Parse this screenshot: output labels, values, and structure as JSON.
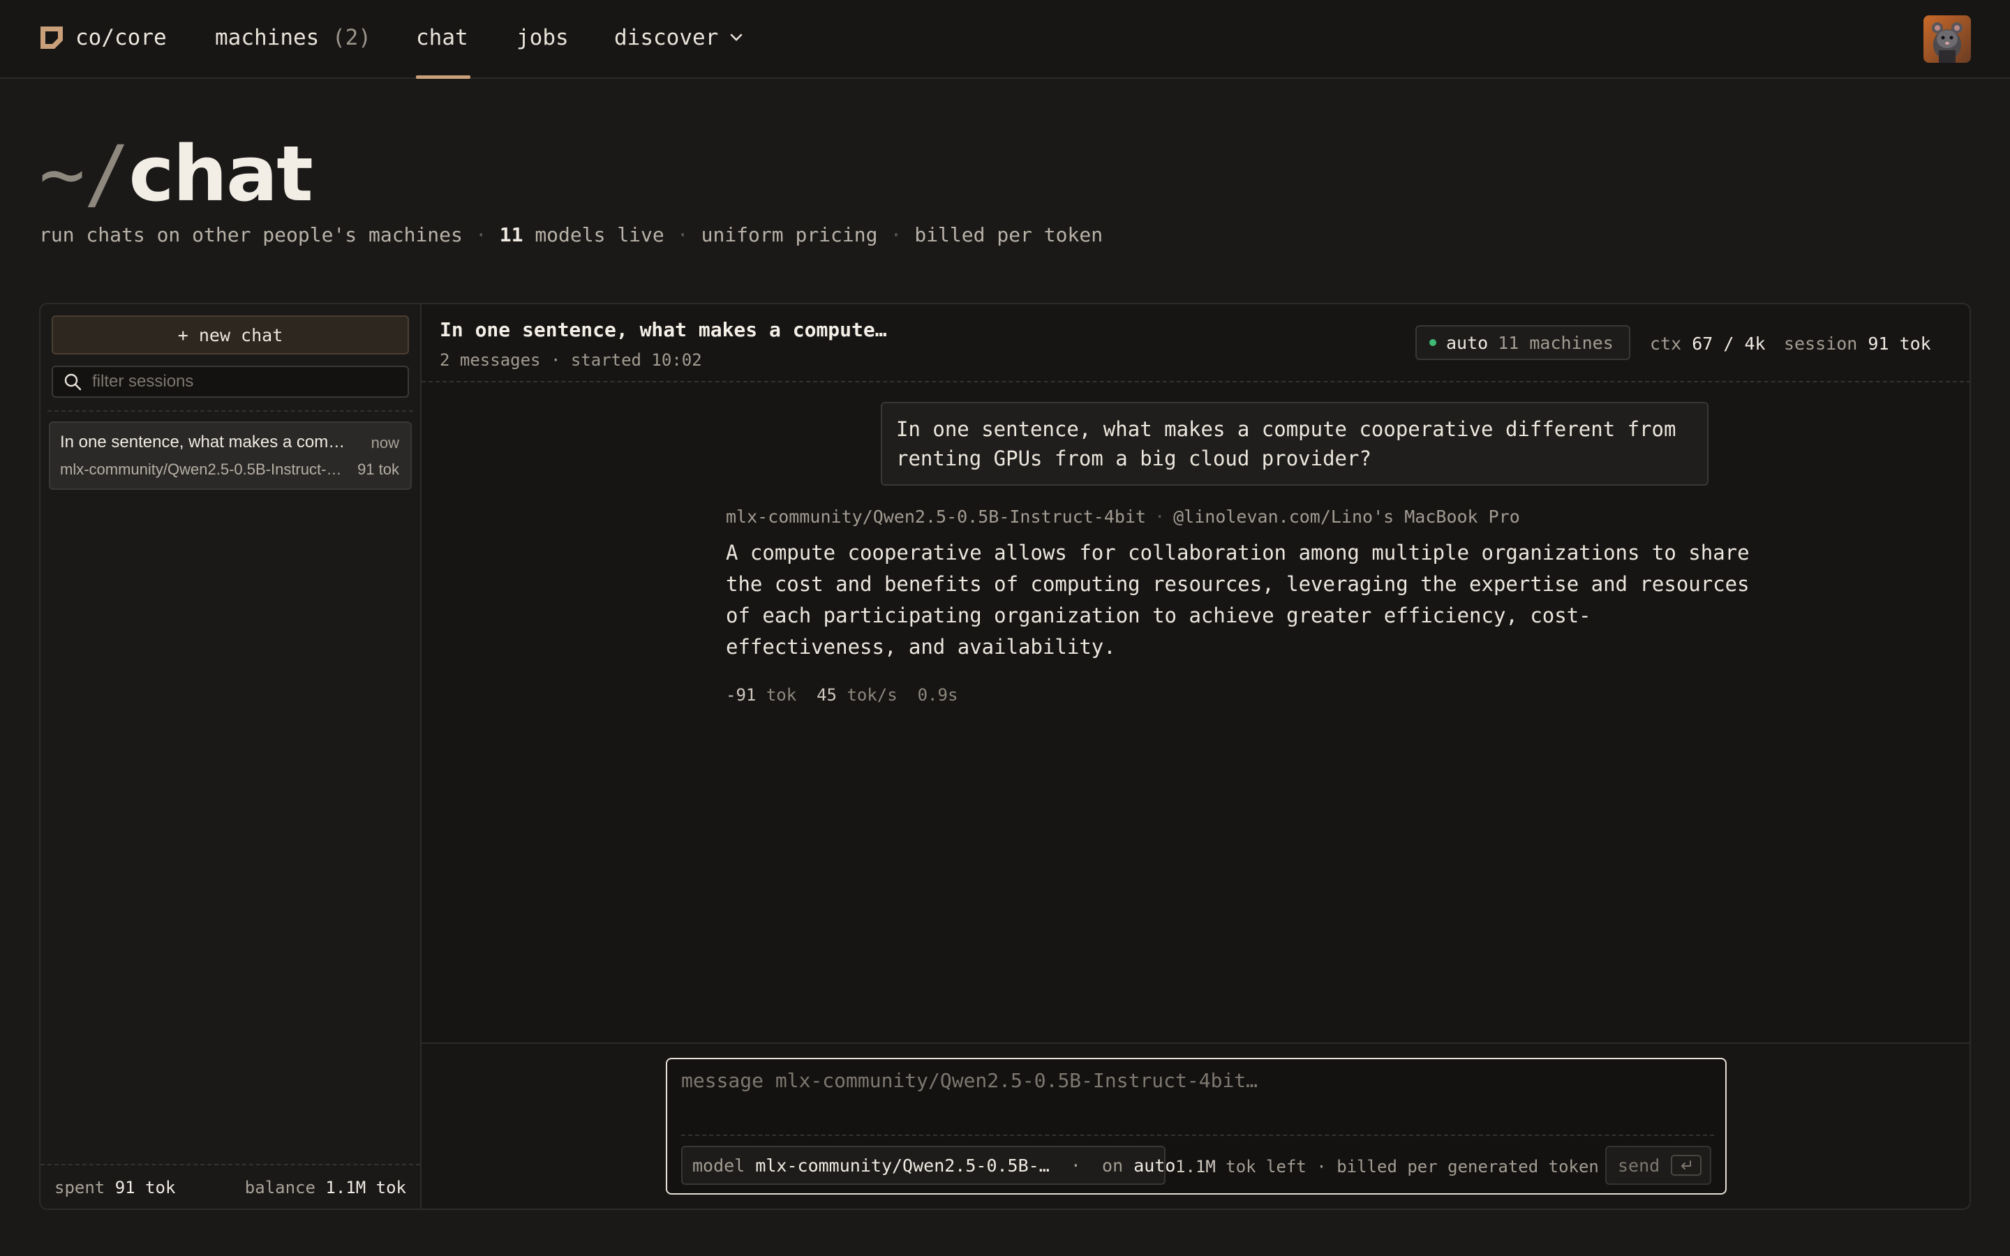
{
  "nav": {
    "brand": "co/core",
    "machines_label": "machines",
    "machines_count": "(2)",
    "chat_label": "chat",
    "jobs_label": "jobs",
    "discover_label": "discover",
    "active": "chat"
  },
  "hero": {
    "prefix": "~/",
    "title": "chat",
    "sub_1": "run chats on other people's machines",
    "models_count": "11",
    "models_label": "models live",
    "pricing": "uniform pricing",
    "billing": "billed per token"
  },
  "sidebar": {
    "new_chat": "+ new chat",
    "filter_placeholder": "filter sessions",
    "sessions": [
      {
        "title": "In one sentence, what makes a compute cooperative different from renting GPUs from a big cloud provider?",
        "time": "now",
        "model": "mlx-community/Qwen2.5-0.5B-Instruct-4bit",
        "tokens": "91 tok"
      }
    ],
    "footer": {
      "spent_label": "spent",
      "spent_value": "91 tok",
      "balance_label": "balance",
      "balance_value": "1.1M tok"
    }
  },
  "chat": {
    "title": "In one sentence, what makes a compute…",
    "meta": "2 messages · started 10:02",
    "routing": {
      "mode": "auto",
      "machines": "11 machines",
      "status_color": "#3fb974"
    },
    "ctx_label": "ctx",
    "ctx_value": "67 / 4k",
    "session_label": "session",
    "session_value": "91 tok",
    "user_message": "In one sentence, what makes a compute cooperative different from renting GPUs from a big cloud provider?",
    "reply_model": "mlx-community/Qwen2.5-0.5B-Instruct-4bit",
    "reply_host": "@linolevan.com/Lino's MacBook Pro",
    "reply_text": "A compute cooperative allows for collaboration among multiple organizations to share the cost and benefits of computing resources, leveraging the expertise and resources of each participating organization to achieve greater efficiency, cost-effectiveness, and availability.",
    "stats": {
      "tokens": "-91",
      "tokens_unit": "tok",
      "speed": "45",
      "speed_unit": "tok/s",
      "latency": "0.9s"
    }
  },
  "composer": {
    "placeholder": "message mlx-community/Qwen2.5-0.5B-Instruct-4bit…",
    "model_label": "model",
    "model_value": "mlx-community/Qwen2.5-0.5B-…",
    "on_label": "on",
    "on_value": "auto",
    "tok_left": "1.1M",
    "tok_left_label": "tok left · billed per generated token",
    "send": "send"
  },
  "colors": {
    "accent": "#c9a07a",
    "background": "#1a1918",
    "status_online": "#3fb974"
  }
}
